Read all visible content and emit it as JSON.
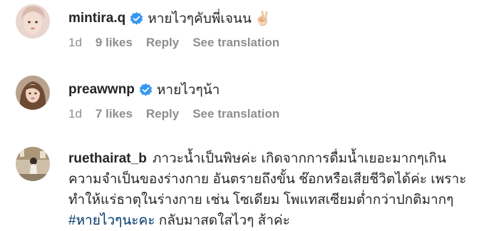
{
  "comments": [
    {
      "username": "mintira.q",
      "verified": true,
      "text": "หายไวๆคับพี่เจนน",
      "emoji": "✌🏻",
      "time": "1d",
      "likes": "9 likes",
      "reply": "Reply",
      "translate": "See translation"
    },
    {
      "username": "preawwnp",
      "verified": true,
      "text": "หายไวๆน้า",
      "time": "1d",
      "likes": "7 likes",
      "reply": "Reply",
      "translate": "See translation"
    },
    {
      "username": "ruethairat_b",
      "verified": false,
      "text_part1": "ภาวะน้ำเป็นพิษค่ะ เกิดจากการดื่มน้ำเยอะมากๆเกิน ความจำเป็นของร่างกาย อันตรายถึงขั้น ช๊อกหรือเสียชีวิตได้ค่ะ เพราะทำให้แร่ธาตุในร่างกาย เช่น โซเดียม โพแทสเซียมต่ำกว่าปกติมากๆ ",
      "hashtag": "#หายไวๆนะคะ",
      "text_part2": " กลับมาสดใสไวๆ ส้าค่ะ"
    }
  ],
  "colors": {
    "verified": "#3897f0",
    "meta": "#8e8e8e",
    "hashtag": "#00376b"
  }
}
